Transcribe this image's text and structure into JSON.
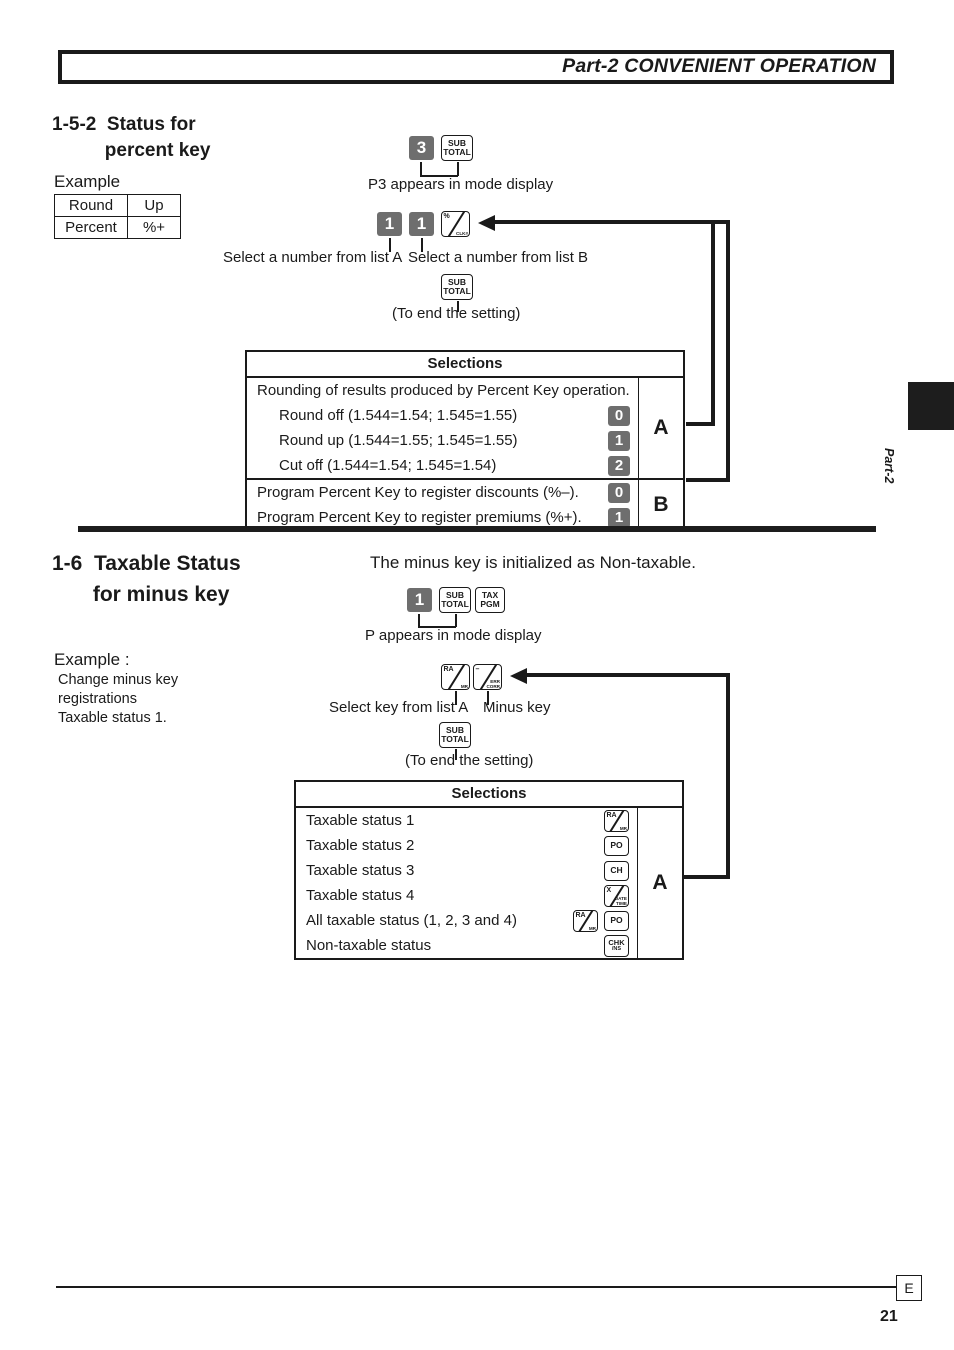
{
  "header": {
    "title": "Part-2 CONVENIENT OPERATION"
  },
  "edge": {
    "tab_label": "Part-2"
  },
  "sections": {
    "percent": {
      "heading": "1-5-2  Status for\n          percent key",
      "example_label": "Example",
      "example_table": {
        "rows": [
          {
            "name": "Round",
            "value": "Up"
          },
          {
            "name": "Percent",
            "value": "%+"
          }
        ]
      },
      "step1": {
        "keys": [
          {
            "type": "num",
            "label": "3"
          },
          {
            "type": "fn",
            "lines": [
              "SUB",
              "TOTAL"
            ]
          }
        ],
        "caption": "P3 appears in mode display"
      },
      "step2": {
        "keys": [
          {
            "type": "num",
            "label": "1"
          },
          {
            "type": "num",
            "label": "1"
          },
          {
            "type": "slash",
            "top": "%",
            "bottom": "CLK#"
          }
        ],
        "caption_a": "Select a number from list A",
        "caption_b": "Select a number from list B"
      },
      "step3": {
        "key": {
          "type": "fn",
          "lines": [
            "SUB",
            "TOTAL"
          ]
        },
        "caption": "(To end the setting)"
      },
      "selections": {
        "header": "Selections",
        "groups": [
          {
            "tag": "A",
            "rows": [
              {
                "text": "Rounding of results produced by Percent Key operation.",
                "indent": false,
                "key": ""
              },
              {
                "text": "Round off (1.544=1.54; 1.545=1.55)",
                "indent": true,
                "key": "0"
              },
              {
                "text": "Round up (1.544=1.55; 1.545=1.55)",
                "indent": true,
                "key": "1"
              },
              {
                "text": "Cut off (1.544=1.54; 1.545=1.54)",
                "indent": true,
                "key": "2"
              }
            ]
          },
          {
            "tag": "B",
            "rows": [
              {
                "text": "Program Percent Key to register discounts (%–).",
                "indent": false,
                "key": "0"
              },
              {
                "text": "Program Percent Key to register premiums (%+).",
                "indent": false,
                "key": "1"
              }
            ]
          }
        ]
      }
    },
    "taxable": {
      "heading": "1-6  Taxable Status\n       for minus key",
      "intro": "The minus key is initialized as Non-taxable.",
      "example_label": "Example :",
      "example_lines": "Change minus key\nregistrations\nTaxable status 1.",
      "step1": {
        "keys": [
          {
            "type": "num",
            "label": "1"
          },
          {
            "type": "fn",
            "lines": [
              "SUB",
              "TOTAL"
            ]
          },
          {
            "type": "fn",
            "lines": [
              "TAX",
              "PGM"
            ]
          }
        ],
        "caption": "P appears in mode display"
      },
      "step2": {
        "keys": [
          {
            "type": "slash",
            "top": "RA",
            "bottom": "MR"
          },
          {
            "type": "slash",
            "top": "–",
            "bottom": "ERR\nCORR"
          }
        ],
        "caption_a": "Select key from list A",
        "caption_b": "Minus key"
      },
      "step3": {
        "key": {
          "type": "fn",
          "lines": [
            "SUB",
            "TOTAL"
          ]
        },
        "caption": "(To end the setting)"
      },
      "selections": {
        "header": "Selections",
        "tag": "A",
        "rows": [
          {
            "text": "Taxable status 1",
            "keys": [
              {
                "type": "slash",
                "top": "RA",
                "bottom": "MR"
              }
            ]
          },
          {
            "text": "Taxable status 2",
            "keys": [
              {
                "type": "fn",
                "lines": [
                  "PO"
                ]
              }
            ]
          },
          {
            "text": "Taxable status 3",
            "keys": [
              {
                "type": "fn",
                "lines": [
                  "CH"
                ]
              }
            ]
          },
          {
            "text": "Taxable status 4",
            "keys": [
              {
                "type": "slash",
                "top": "X",
                "bottom": "DATE\nTIME"
              }
            ]
          },
          {
            "text": "All taxable status (1, 2, 3 and 4)",
            "keys": [
              {
                "type": "slash",
                "top": "RA",
                "bottom": "MR"
              },
              {
                "type": "fn",
                "lines": [
                  "PO"
                ]
              }
            ]
          },
          {
            "text": "Non-taxable status",
            "keys": [
              {
                "type": "fn",
                "lines": [
                  "CHK",
                  "/NS"
                ]
              }
            ]
          }
        ]
      }
    }
  },
  "footer": {
    "marker": "E",
    "page_number": "21"
  }
}
